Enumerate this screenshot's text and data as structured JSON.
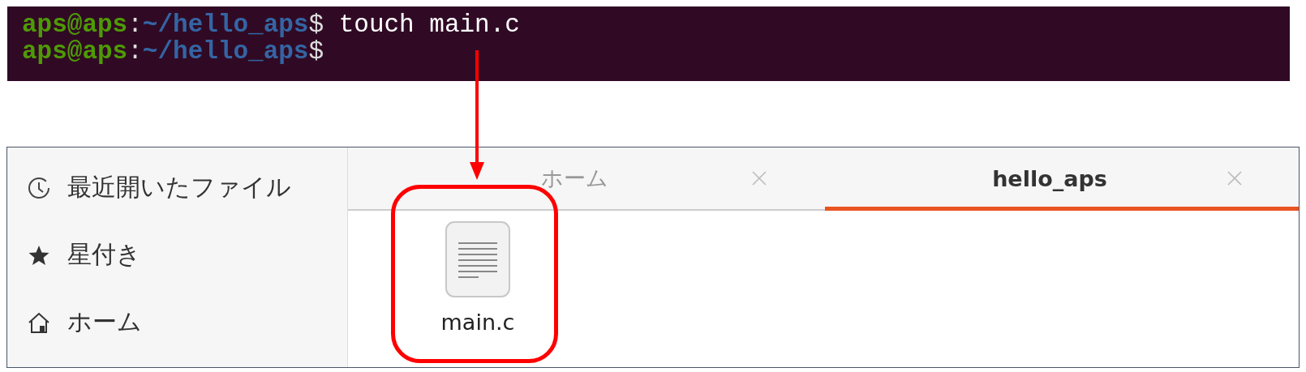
{
  "terminal": {
    "lines": [
      {
        "user": "aps@aps",
        "separator": ":",
        "path": "~/hello_aps",
        "symbol": "$",
        "command": "touch main.c"
      },
      {
        "user": "aps@aps",
        "separator": ":",
        "path": "~/hello_aps",
        "symbol": "$"
      }
    ]
  },
  "file_manager": {
    "sidebar": {
      "items": [
        {
          "kind": "recent",
          "label": "最近開いたファイル",
          "selected": false
        },
        {
          "kind": "starred",
          "label": "星付き",
          "selected": false
        },
        {
          "kind": "home",
          "label": "ホーム",
          "selected": false
        }
      ]
    },
    "tabs": [
      {
        "label": "ホーム",
        "selected": false
      },
      {
        "label": "hello_aps",
        "selected": true
      }
    ],
    "files": [
      {
        "kind": "text",
        "name": "main.c"
      }
    ]
  }
}
